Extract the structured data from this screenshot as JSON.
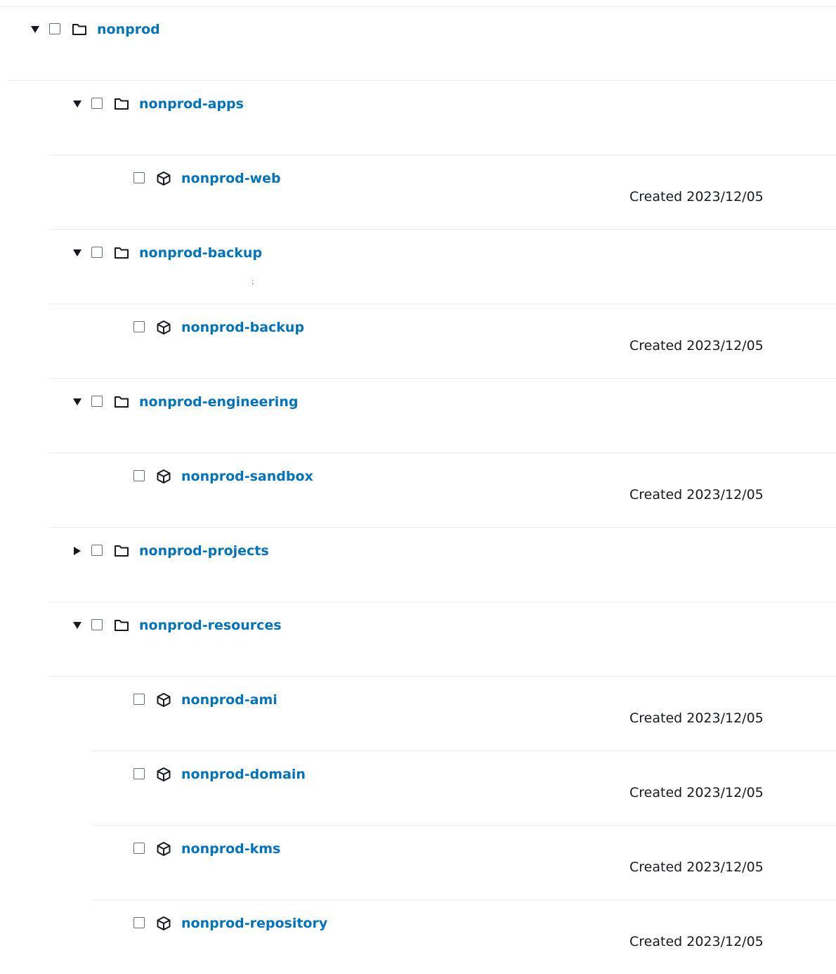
{
  "colors": {
    "link": "#0073bb",
    "text": "#16191f",
    "divider": "#eaeded",
    "control_border": "#687078"
  },
  "tree": [
    {
      "name": "nonprod",
      "kind": "folder",
      "depth": 0,
      "expanded": true,
      "meta": "",
      "icon": "folder-icon"
    },
    {
      "name": "nonprod-apps",
      "kind": "folder",
      "depth": 1,
      "expanded": true,
      "meta": "",
      "icon": "folder-icon"
    },
    {
      "name": "nonprod-web",
      "kind": "account",
      "depth": 2,
      "meta": "Created 2023/12/05",
      "icon": "cube-icon"
    },
    {
      "name": "nonprod-backup",
      "kind": "folder",
      "depth": 1,
      "expanded": true,
      "meta": "",
      "icon": "folder-icon"
    },
    {
      "name": "nonprod-backup",
      "kind": "account",
      "depth": 2,
      "meta": "Created 2023/12/05",
      "icon": "cube-icon"
    },
    {
      "name": "nonprod-engineering",
      "kind": "folder",
      "depth": 1,
      "expanded": true,
      "meta": "",
      "icon": "folder-icon"
    },
    {
      "name": "nonprod-sandbox",
      "kind": "account",
      "depth": 2,
      "meta": "Created 2023/12/05",
      "icon": "cube-icon"
    },
    {
      "name": "nonprod-projects",
      "kind": "folder",
      "depth": 1,
      "expanded": false,
      "meta": "",
      "icon": "folder-icon"
    },
    {
      "name": "nonprod-resources",
      "kind": "folder",
      "depth": 1,
      "expanded": true,
      "meta": "",
      "icon": "folder-icon"
    },
    {
      "name": "nonprod-ami",
      "kind": "account",
      "depth": 2,
      "meta": "Created 2023/12/05",
      "icon": "cube-icon"
    },
    {
      "name": "nonprod-domain",
      "kind": "account",
      "depth": 2,
      "meta": "Created 2023/12/05",
      "icon": "cube-icon"
    },
    {
      "name": "nonprod-kms",
      "kind": "account",
      "depth": 2,
      "meta": "Created 2023/12/05",
      "icon": "cube-icon"
    },
    {
      "name": "nonprod-repository",
      "kind": "account",
      "depth": 2,
      "meta": "Created 2023/12/05",
      "icon": "cube-icon"
    }
  ]
}
